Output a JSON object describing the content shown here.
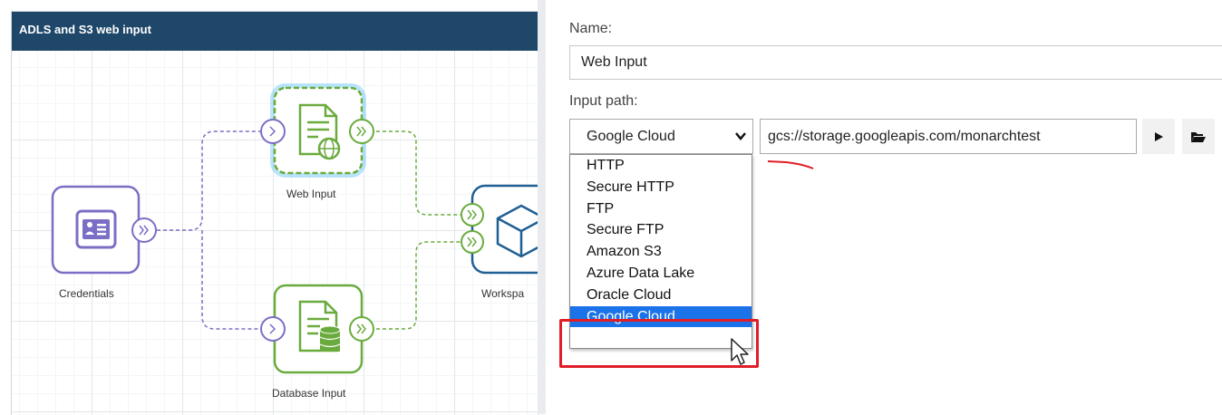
{
  "canvas": {
    "title": "ADLS and S3 web input",
    "nodes": {
      "credentials": "Credentials",
      "web_input": "Web Input",
      "database_input": "Database Input",
      "workspace": "Workspa"
    },
    "icons": {
      "credentials": "id-card-icon",
      "web_input": "web-document-icon",
      "database_input": "database-document-icon",
      "workspace": "cube-icon",
      "ports": "double-chevron-port-icon"
    },
    "colors": {
      "header": "#1e4769",
      "credentials_node": "#7b6fc5",
      "input_nodes": "#6aab3e",
      "workspace_node": "#1f5f94",
      "selection_glow": "#3fb6f5"
    }
  },
  "form": {
    "name_label": "Name:",
    "name_value": "Web Input",
    "input_path_label": "Input path:",
    "protocol_selected": "Google Cloud",
    "path_value": "gcs://storage.googleapis.com/monarchtest",
    "buttons": [
      "play-icon",
      "folder-open-icon"
    ],
    "protocol_options": [
      "HTTP",
      "Secure HTTP",
      "FTP",
      "Secure FTP",
      "Amazon S3",
      "Azure Data Lake",
      "Oracle Cloud",
      "Google Cloud"
    ],
    "selected_option_index": 7,
    "colors": {
      "selection": "#1a73e8",
      "annotation": "#e01e27"
    }
  }
}
